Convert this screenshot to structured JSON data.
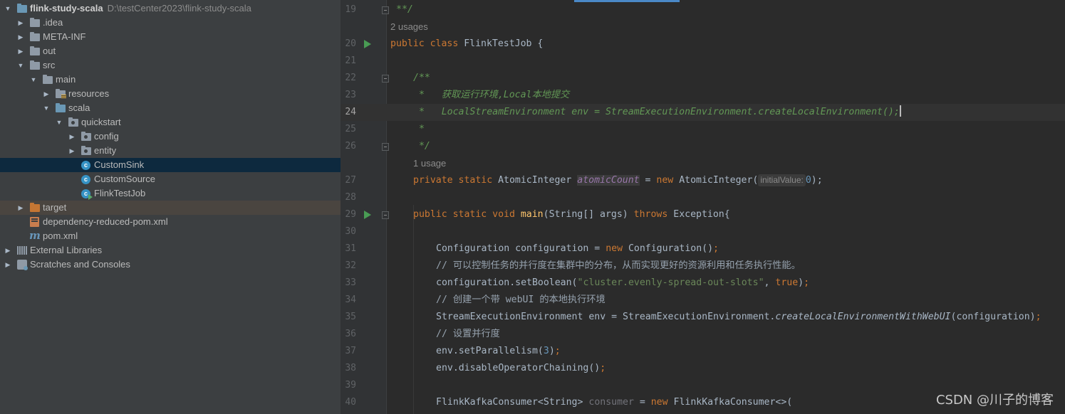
{
  "project_tree": {
    "root": {
      "name": "flink-study-scala",
      "path": "D:\\testCenter2023\\flink-study-scala"
    },
    "items": [
      {
        "label": ".idea"
      },
      {
        "label": "META-INF"
      },
      {
        "label": "out"
      },
      {
        "label": "src"
      },
      {
        "label": "main"
      },
      {
        "label": "resources"
      },
      {
        "label": "scala"
      },
      {
        "label": "quickstart"
      },
      {
        "label": "config"
      },
      {
        "label": "entity"
      },
      {
        "label": "CustomSink"
      },
      {
        "label": "CustomSource"
      },
      {
        "label": "FlinkTestJob"
      },
      {
        "label": "target"
      },
      {
        "label": "dependency-reduced-pom.xml"
      },
      {
        "label": "pom.xml"
      },
      {
        "label": "External Libraries"
      },
      {
        "label": "Scratches and Consoles"
      }
    ],
    "selected": "CustomSink"
  },
  "editor": {
    "line_numbers": [
      "19",
      "20",
      "21",
      "22",
      "23",
      "24",
      "25",
      "26",
      "27",
      "28",
      "29",
      "30",
      "31",
      "32",
      "33",
      "34",
      "35",
      "36",
      "37",
      "38",
      "39",
      "40"
    ],
    "current_line": "24",
    "usages": {
      "class_usages": "2 usages",
      "field_usages": "1 usage"
    },
    "code": {
      "l19": "**/",
      "l20_kw": "public class ",
      "l20_name": "FlinkTestJob {",
      "l22": "/**",
      "l23": " *   获取运行环境,Local本地提交",
      "l24": " *   LocalStreamEnvironment env = StreamExecutionEnvironment.createLocalEnvironment();",
      "l25": " *",
      "l26": " */",
      "l27_kw": "private static ",
      "l27_type": "AtomicInteger ",
      "l27_field": "atomicCount",
      "l27_eq": " = ",
      "l27_new": "new ",
      "l27_ctor": "AtomicInteger(",
      "l27_hint": "initialValue:",
      "l27_num": "0",
      "l27_end": ");",
      "l29_kw": "public static void ",
      "l29_fn": "main",
      "l29_args": "(String[] args) ",
      "l29_throws": "throws ",
      "l29_exc": "Exception{",
      "l31_a": "Configuration configuration = ",
      "l31_new": "new ",
      "l31_b": "Configuration()",
      "l31_semi": ";",
      "l32": "// 可以控制任务的并行度在集群中的分布，从而实现更好的资源利用和任务执行性能。",
      "l33_a": "configuration.setBoolean(",
      "l33_str": "\"cluster.evenly-spread-out-slots\"",
      "l33_comma": ", ",
      "l33_true": "true",
      "l33_end": ")",
      "l33_semi": ";",
      "l34": "// 创建一个带 webUI 的本地执行环境",
      "l35_a": "StreamExecutionEnvironment env = StreamExecutionEnvironment.",
      "l35_it": "createLocalEnvironmentWithWebUI",
      "l35_b": "(configuration)",
      "l35_semi": ";",
      "l36": "// 设置并行度",
      "l37_a": "env.setParallelism(",
      "l37_num": "3",
      "l37_b": ")",
      "l37_semi": ";",
      "l38_a": "env.disableOperatorChaining()",
      "l38_semi": ";",
      "l40_a": "FlinkKafkaConsumer<String> ",
      "l40_var": "consumer",
      "l40_eq": " = ",
      "l40_new": "new ",
      "l40_b": "FlinkKafkaConsumer<>("
    }
  },
  "watermark": "CSDN @川子的博客",
  "colors": {
    "keyword": "#cc7832",
    "doc_comment": "#629755",
    "string": "#6a8759",
    "number": "#6897bb",
    "field": "#9876aa",
    "method": "#ffc66d",
    "selection": "#0d293e"
  }
}
